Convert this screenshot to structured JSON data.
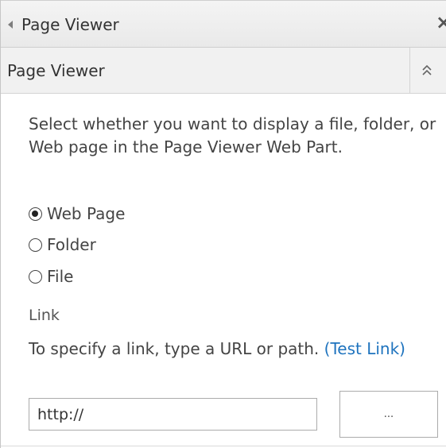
{
  "tool_pane": {
    "title": "Page Viewer",
    "back_icon": "triangle-left-icon",
    "close_icon": "close-icon",
    "close_glyph": "×"
  },
  "section": {
    "title": "Page Viewer",
    "toggle_icon": "chevron-double-up-icon"
  },
  "description": "Select whether you want to display a file, folder, or Web page in the Page Viewer Web Part.",
  "options": [
    {
      "label": "Web Page",
      "checked": true
    },
    {
      "label": "Folder",
      "checked": false
    },
    {
      "label": "File",
      "checked": false
    }
  ],
  "link": {
    "heading": "Link",
    "help_text": "To specify a link, type a URL or path.",
    "test_link_label": "(Test Link)",
    "input_value": "http://",
    "browse_label": "..."
  },
  "colors": {
    "link": "#1e73be",
    "title_bar": "#ececec",
    "section_header": "#f1f1f1"
  }
}
